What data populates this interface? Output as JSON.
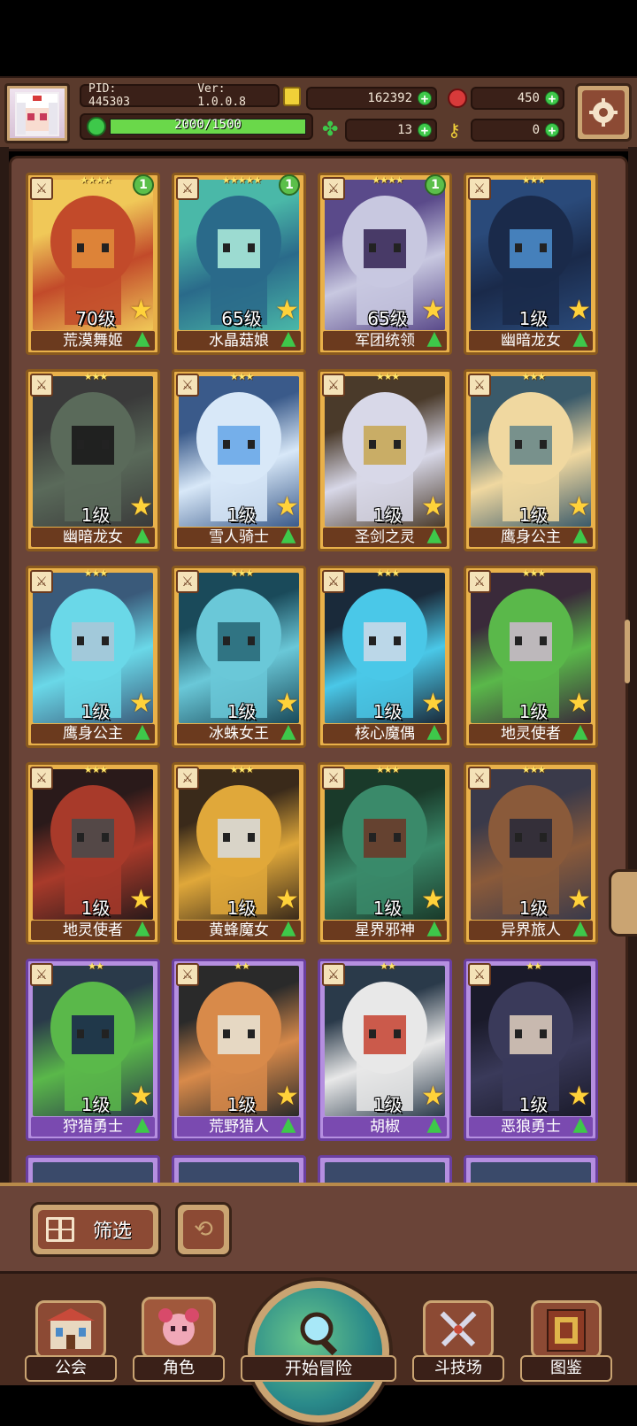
{
  "header": {
    "pid": "PID: 445303",
    "version": "Ver: 1.0.0.8",
    "exp_text": "2000/1500",
    "exp_progress": 1.0,
    "gold": "162392",
    "gems": "450",
    "clover": "13",
    "keys": "0"
  },
  "heroes": [
    {
      "name": "荒漠舞姬",
      "level": "70级",
      "stars": "★★★★",
      "rarity": "gold",
      "badge": "1",
      "art": [
        "#f0c858",
        "#c24a2a",
        "#e08a3a"
      ]
    },
    {
      "name": "水晶菇娘",
      "level": "65级",
      "stars": "★★★★★",
      "rarity": "gold",
      "badge": "1",
      "art": [
        "#4ab8a8",
        "#2a6a8a",
        "#a8e8d8"
      ]
    },
    {
      "name": "军团统领",
      "level": "65级",
      "stars": "★★★★",
      "rarity": "gold",
      "badge": "1",
      "art": [
        "#5a4a8a",
        "#c8c8e0",
        "#3a2a5a"
      ]
    },
    {
      "name": "幽暗龙女",
      "level": "1级",
      "stars": "★★★",
      "rarity": "gold",
      "badge": "",
      "art": [
        "#2a4a7a",
        "#1a2a4a",
        "#4a8ac8"
      ]
    },
    {
      "name": "幽暗龙女",
      "level": "1级",
      "stars": "★★★",
      "rarity": "gold",
      "badge": "",
      "art": [
        "#3a3a3a",
        "#5a6a5a",
        "#1a1a1a"
      ]
    },
    {
      "name": "雪人骑士",
      "level": "1级",
      "stars": "★★★",
      "rarity": "gold",
      "badge": "",
      "art": [
        "#3a5a8a",
        "#d8e8f8",
        "#6aa8e8"
      ]
    },
    {
      "name": "圣剑之灵",
      "level": "1级",
      "stars": "★★★",
      "rarity": "gold",
      "badge": "",
      "art": [
        "#4a3a2a",
        "#d8d8e8",
        "#c8a858"
      ]
    },
    {
      "name": "鹰身公主",
      "level": "1级",
      "stars": "★★★",
      "rarity": "gold",
      "badge": "",
      "art": [
        "#3a5a6a",
        "#f0d8a0",
        "#6a8a8a"
      ]
    },
    {
      "name": "鹰身公主",
      "level": "1级",
      "stars": "★★★",
      "rarity": "gold",
      "badge": "",
      "art": [
        "#3a5a7a",
        "#6ad8e8",
        "#a8c8d8"
      ]
    },
    {
      "name": "冰蛛女王",
      "level": "1级",
      "stars": "★★★",
      "rarity": "gold",
      "badge": "",
      "art": [
        "#1a4a5a",
        "#6ac8d8",
        "#2a6a7a"
      ]
    },
    {
      "name": "核心魔偶",
      "level": "1级",
      "stars": "★★★",
      "rarity": "gold",
      "badge": "",
      "art": [
        "#1a2a3a",
        "#4ac8e8",
        "#c8d8e8"
      ]
    },
    {
      "name": "地灵使者",
      "level": "1级",
      "stars": "★★★",
      "rarity": "gold",
      "badge": "",
      "art": [
        "#3a2a3a",
        "#5ab84a",
        "#c8b8c8"
      ]
    },
    {
      "name": "地灵使者",
      "level": "1级",
      "stars": "★★★",
      "rarity": "gold",
      "badge": "",
      "art": [
        "#2a1a1a",
        "#a83a2a",
        "#4a4a4a"
      ]
    },
    {
      "name": "黄蜂魔女",
      "level": "1级",
      "stars": "★★★",
      "rarity": "gold",
      "badge": "",
      "art": [
        "#3a2a1a",
        "#e0a83a",
        "#d8d8d8"
      ]
    },
    {
      "name": "星界邪神",
      "level": "1级",
      "stars": "★★★",
      "rarity": "gold",
      "badge": "",
      "art": [
        "#1a3a2a",
        "#3a8a6a",
        "#6a3a2a"
      ]
    },
    {
      "name": "异界旅人",
      "level": "1级",
      "stars": "★★★",
      "rarity": "gold",
      "badge": "",
      "art": [
        "#3a3a4a",
        "#8a5a3a",
        "#2a2a3a"
      ]
    },
    {
      "name": "狩猎勇士",
      "level": "1级",
      "stars": "★★",
      "rarity": "purple",
      "badge": "",
      "art": [
        "#2a3a4a",
        "#5ab84a",
        "#1a2a4a"
      ]
    },
    {
      "name": "荒野猎人",
      "level": "1级",
      "stars": "★★",
      "rarity": "purple",
      "badge": "",
      "art": [
        "#2a2a2a",
        "#d88a4a",
        "#e8e0d0"
      ]
    },
    {
      "name": "胡椒",
      "level": "1级",
      "stars": "★★",
      "rarity": "purple",
      "badge": "",
      "art": [
        "#2a3a4a",
        "#e8e8e8",
        "#c84a3a"
      ]
    },
    {
      "name": "恶狼勇士",
      "level": "1级",
      "stars": "★★",
      "rarity": "purple",
      "badge": "",
      "art": [
        "#1a1a2a",
        "#3a3a5a",
        "#d8c8b8"
      ]
    }
  ],
  "filter": {
    "label": "筛选"
  },
  "nav": [
    {
      "label": "公会"
    },
    {
      "label": "角色"
    },
    {
      "label": "开始冒险"
    },
    {
      "label": "斗技场"
    },
    {
      "label": "图鉴"
    }
  ]
}
